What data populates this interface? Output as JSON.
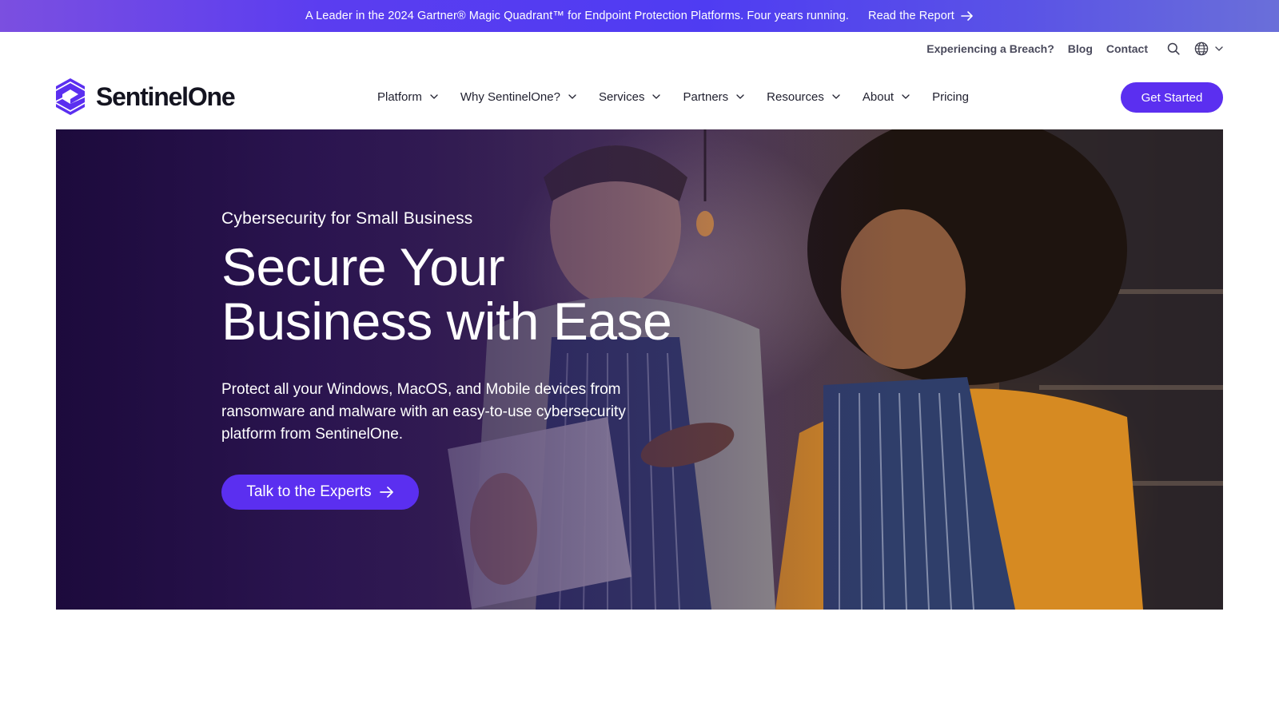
{
  "banner": {
    "text": "A Leader in the 2024 Gartner® Magic Quadrant™ for Endpoint Protection Platforms. Four years running.",
    "link_label": "Read the Report",
    "link_icon": "arrow-right-icon"
  },
  "utility_nav": {
    "items": [
      {
        "label": "Experiencing a Breach?"
      },
      {
        "label": "Blog"
      },
      {
        "label": "Contact"
      }
    ],
    "search_icon": "search-icon",
    "language_icon": "globe-icon"
  },
  "brand": {
    "name": "SentinelOne",
    "logo_color": "#5b2ff0"
  },
  "main_nav": {
    "items": [
      {
        "label": "Platform",
        "has_dropdown": true
      },
      {
        "label": "Why SentinelOne?",
        "has_dropdown": true
      },
      {
        "label": "Services",
        "has_dropdown": true
      },
      {
        "label": "Partners",
        "has_dropdown": true
      },
      {
        "label": "Resources",
        "has_dropdown": true
      },
      {
        "label": "About",
        "has_dropdown": true
      },
      {
        "label": "Pricing",
        "has_dropdown": false
      }
    ],
    "cta_label": "Get Started"
  },
  "hero": {
    "eyebrow": "Cybersecurity for Small Business",
    "headline_line1": "Secure Your",
    "headline_line2": "Business with Ease",
    "subcopy": "Protect all your Windows, MacOS, and Mobile devices from ransomware and malware with an easy-to-use cybersecurity platform from SentinelOne.",
    "cta_label": "Talk to the Experts",
    "cta_icon": "arrow-right-icon"
  },
  "colors": {
    "accent": "#5b2ff0",
    "banner_gradient_start": "#7b4fe0",
    "banner_gradient_end": "#6a6fd9",
    "text_dark": "#1f1f2e"
  }
}
